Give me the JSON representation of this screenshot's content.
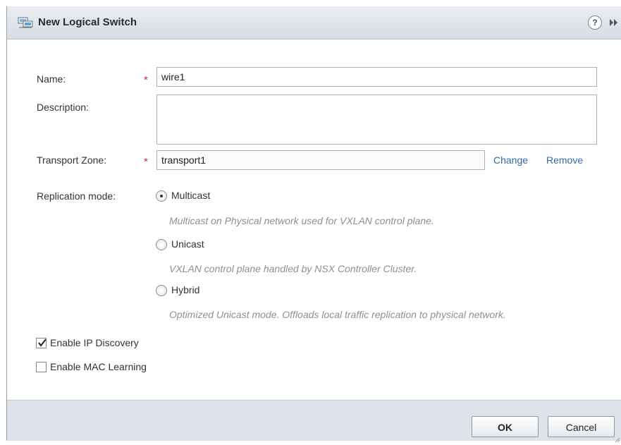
{
  "dialog": {
    "title": "New Logical Switch",
    "icons": {
      "title": "logical-switch-icon",
      "help": "help-icon",
      "expand": "expand-icon"
    },
    "help_glyph": "?"
  },
  "form": {
    "name": {
      "label": "Name:",
      "value": "wire1",
      "required_mark": "*"
    },
    "description": {
      "label": "Description:",
      "value": ""
    },
    "transport_zone": {
      "label": "Transport Zone:",
      "value": "transport1",
      "required_mark": "*",
      "change_label": "Change",
      "remove_label": "Remove"
    },
    "replication": {
      "label": "Replication mode:",
      "selected": "Multicast",
      "options": [
        {
          "label": "Multicast",
          "hint": "Multicast on Physical network used for VXLAN control plane.",
          "checked": true
        },
        {
          "label": "Unicast",
          "hint": "VXLAN control plane handled by NSX Controller Cluster.",
          "checked": false
        },
        {
          "label": "Hybrid",
          "hint": "Optimized Unicast mode. Offloads local traffic replication to physical network.",
          "checked": false
        }
      ]
    },
    "ip_discovery": {
      "label": "Enable IP Discovery",
      "checked": true
    },
    "mac_learning": {
      "label": "Enable MAC Learning",
      "checked": false
    }
  },
  "footer": {
    "ok_label": "OK",
    "cancel_label": "Cancel"
  },
  "colors": {
    "required": "#d12a2a",
    "link": "#2e6aa8",
    "hint": "#8b9095",
    "footer_bg": "#dde3e9"
  }
}
